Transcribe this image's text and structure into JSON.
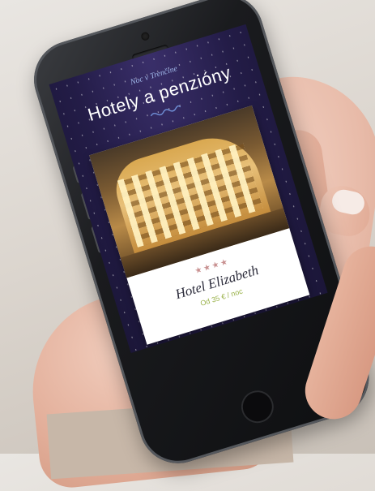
{
  "screen": {
    "kicker": "Noc v Trenčíne",
    "title": "Hotely a penzióny",
    "card": {
      "rating": "★★★★",
      "name": "Hotel Elizabeth",
      "price": "Od 35 € / noc"
    }
  },
  "colors": {
    "screen_bg": "#231c47",
    "kicker": "#9fb6e8",
    "price": "#9ab24a"
  }
}
